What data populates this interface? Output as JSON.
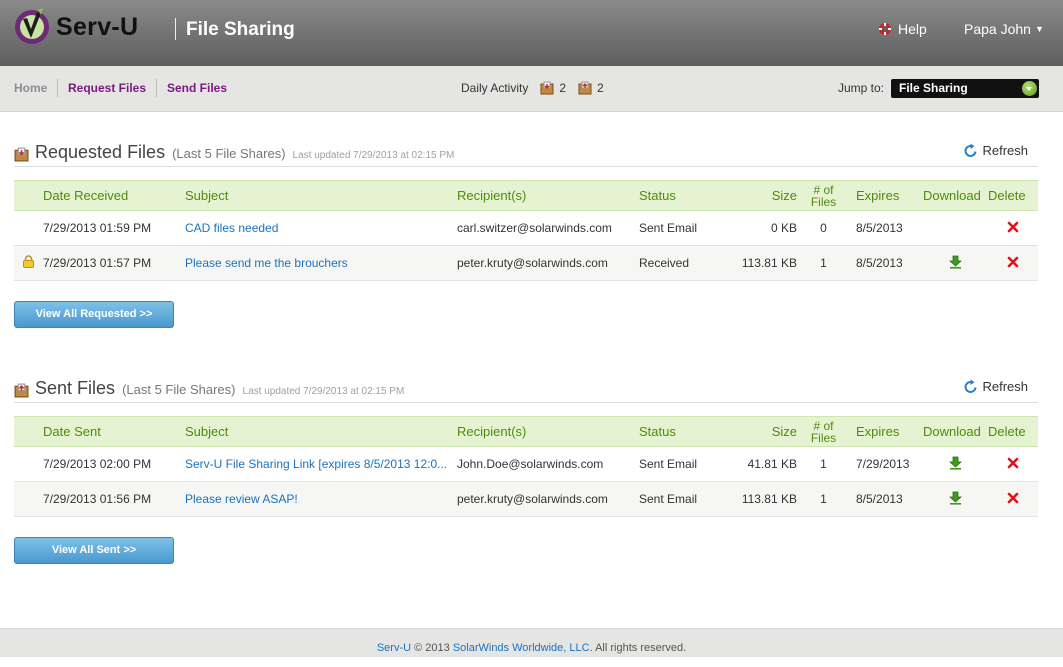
{
  "header": {
    "brand": "Serv-U",
    "app_title": "File Sharing",
    "help_label": "Help",
    "user_name": "Papa John"
  },
  "nav": {
    "home": "Home",
    "request_files": "Request Files",
    "send_files": "Send Files",
    "daily_activity_label": "Daily Activity",
    "daily_requested_count": "2",
    "daily_sent_count": "2",
    "jump_label": "Jump to:",
    "jump_selected": "File Sharing"
  },
  "requested": {
    "title": "Requested Files",
    "subtitle": "(Last 5 File Shares)",
    "updated": "Last updated 7/29/2013 at 02:15 PM",
    "refresh_label": "Refresh",
    "columns": {
      "date": "Date Received",
      "subject": "Subject",
      "recipients": "Recipient(s)",
      "status": "Status",
      "size": "Size",
      "num_files_line1": "# of",
      "num_files_line2": "Files",
      "expires": "Expires",
      "download": "Download",
      "delete": "Delete"
    },
    "rows": [
      {
        "locked": false,
        "date": "7/29/2013 01:59 PM",
        "subject": "CAD files needed",
        "recipient": "carl.switzer@solarwinds.com",
        "status": "Sent Email",
        "size": "0 KB",
        "files": "0",
        "expires": "8/5/2013",
        "downloadable": false
      },
      {
        "locked": true,
        "date": "7/29/2013 01:57 PM",
        "subject": "Please send me the brouchers",
        "recipient": "peter.kruty@solarwinds.com",
        "status": "Received",
        "size": "113.81 KB",
        "files": "1",
        "expires": "8/5/2013",
        "downloadable": true
      }
    ],
    "view_all_label": "View All Requested >>"
  },
  "sent": {
    "title": "Sent Files",
    "subtitle": "(Last 5 File Shares)",
    "updated": "Last updated 7/29/2013 at 02:15 PM",
    "refresh_label": "Refresh",
    "columns": {
      "date": "Date Sent",
      "subject": "Subject",
      "recipients": "Recipient(s)",
      "status": "Status",
      "size": "Size",
      "num_files_line1": "# of",
      "num_files_line2": "Files",
      "expires": "Expires",
      "download": "Download",
      "delete": "Delete"
    },
    "rows": [
      {
        "locked": false,
        "date": "7/29/2013 02:00 PM",
        "subject": "Serv-U File Sharing Link [expires 8/5/2013 12:0...",
        "recipient": "John.Doe@solarwinds.com",
        "status": "Sent Email",
        "size": "41.81 KB",
        "files": "1",
        "expires": "7/29/2013",
        "downloadable": true
      },
      {
        "locked": false,
        "date": "7/29/2013 01:56 PM",
        "subject": "Please review ASAP!",
        "recipient": "peter.kruty@solarwinds.com",
        "status": "Sent Email",
        "size": "113.81 KB",
        "files": "1",
        "expires": "8/5/2013",
        "downloadable": true
      }
    ],
    "view_all_label": "View All Sent >>"
  },
  "footer": {
    "product_link": "Serv-U",
    "copyright": " © 2013 ",
    "company_link": "SolarWinds Worldwide, LLC",
    "rights": ". All rights reserved."
  },
  "icons": {
    "logo": "serv-u-logo",
    "help": "lifebuoy-icon",
    "refresh": "refresh-icon",
    "download": "download-arrow-icon",
    "delete": "red-x-icon",
    "lock": "lock-icon"
  },
  "colors": {
    "link": "#1a73c0",
    "nav_link": "#7b1a80",
    "table_header_text": "#4d8c0d",
    "table_header_bg": "#e6f3d2",
    "delete": "#e0141b",
    "download": "#3d9b1e"
  }
}
